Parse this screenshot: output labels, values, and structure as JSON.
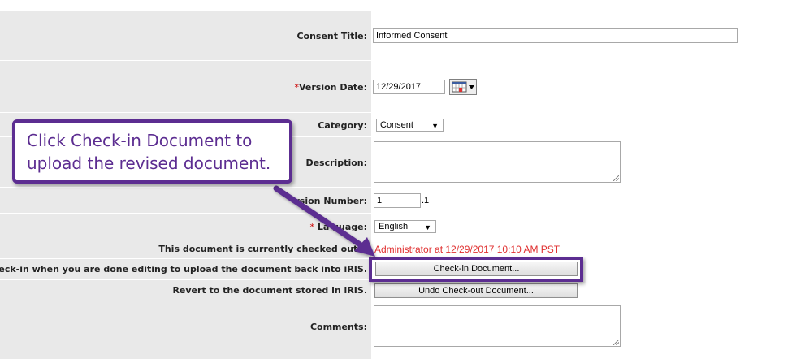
{
  "form": {
    "consent_title_label": "Consent Title:",
    "consent_title_value": "Informed Consent",
    "version_date_required": "*",
    "version_date_label": "Version Date:",
    "version_date_value": "12/29/2017",
    "category_label": "Category:",
    "category_value": "Consent",
    "description_label": "Description:",
    "description_value": "",
    "version_number_label": "rsion Number:",
    "version_number_value": "1",
    "version_number_suffix": ".1",
    "language_required": "*",
    "language_label": "La  guage:",
    "language_value": "English",
    "checked_out_label": "This document is currently checked out b",
    "checked_out_value": "Administrator at 12/29/2017 10:10 AM PST",
    "checkin_label": "Check-in when you are done editing to upload the document back into iRIS.",
    "checkin_button": "Check-in Document...",
    "revert_label": "Revert to the document stored in iRIS.",
    "undo_button": "Undo Check-out Document...",
    "comments_label": "Comments:",
    "comments_value": ""
  },
  "callout": {
    "text": "Click Check-in Document to upload the revised document."
  },
  "colors": {
    "callout_purple": "#5c2d91",
    "label_bg": "#e9e9e9",
    "checked_out_red": "#e03030",
    "required_red": "#cc0000"
  },
  "icons": {
    "calendar": "calendar-icon",
    "dropdown": "chevron-down-icon"
  }
}
